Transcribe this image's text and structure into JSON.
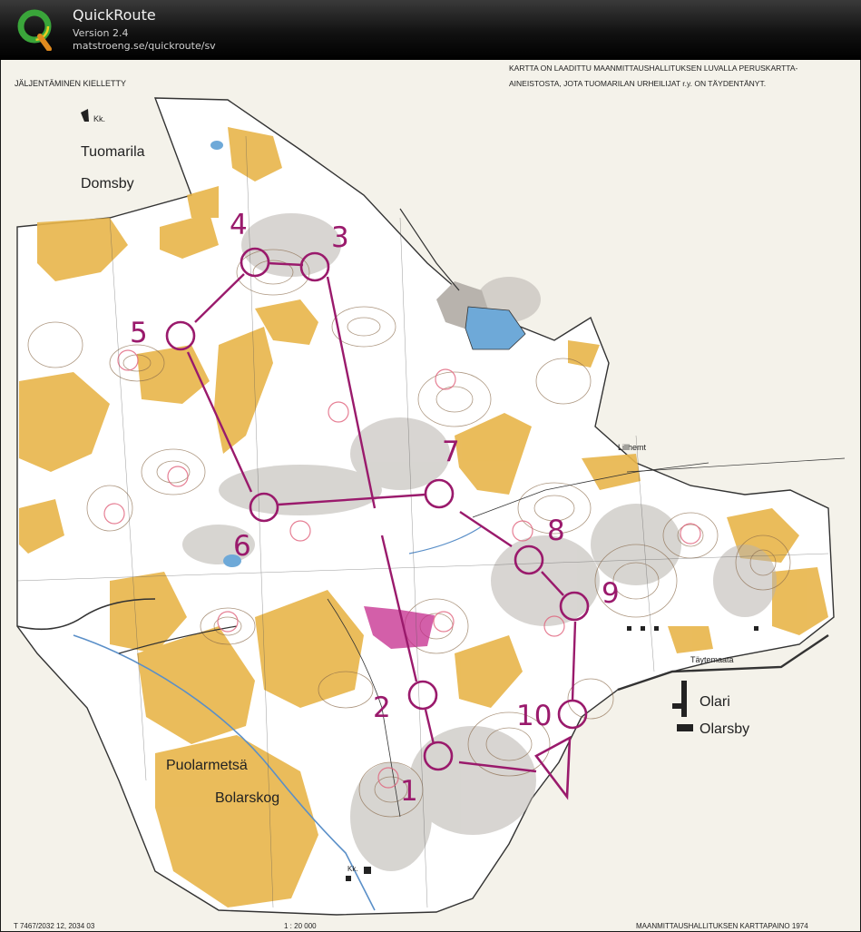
{
  "app": {
    "name": "QuickRoute",
    "version": "Version 2.4",
    "url": "matstroeng.se/quickroute/sv"
  },
  "map": {
    "copy_notice": "JÄLJENTÄMINEN KIELLETTY",
    "credit_line1": "KARTTA ON LAADITTU MAANMITTAUSHALLITUKSEN LUVALLA PERUSKARTTA-",
    "credit_line2": "AINEISTOSTA, JOTA TUOMARILAN URHEILIJAT r.y. ON TÄYDENTÄNYT.",
    "place_names": {
      "tuomarila": "Tuomarila",
      "domsby": "Domsby",
      "lillhemt": "Lillhemt",
      "taytemaata": "Täytemaata",
      "olari": "Olari",
      "olarsby": "Olarsby",
      "puolarmetsa": "Puolarmetsä",
      "bolarskog": "Bolarskog",
      "kk_top": "Kk.",
      "kk_bottom": "Kk."
    },
    "footer_left": "T 7467/2032 12, 2034 03",
    "scale": "1 : 20 000",
    "footer_right": "MAANMITTAUSHALLITUKSEN KARTTAPAINO 1974",
    "course_color": "#9a1a6c",
    "controls": [
      {
        "label": "1"
      },
      {
        "label": "2"
      },
      {
        "label": "3"
      },
      {
        "label": "4"
      },
      {
        "label": "5"
      },
      {
        "label": "6"
      },
      {
        "label": "7"
      },
      {
        "label": "8"
      },
      {
        "label": "9"
      },
      {
        "label": "10"
      }
    ]
  }
}
